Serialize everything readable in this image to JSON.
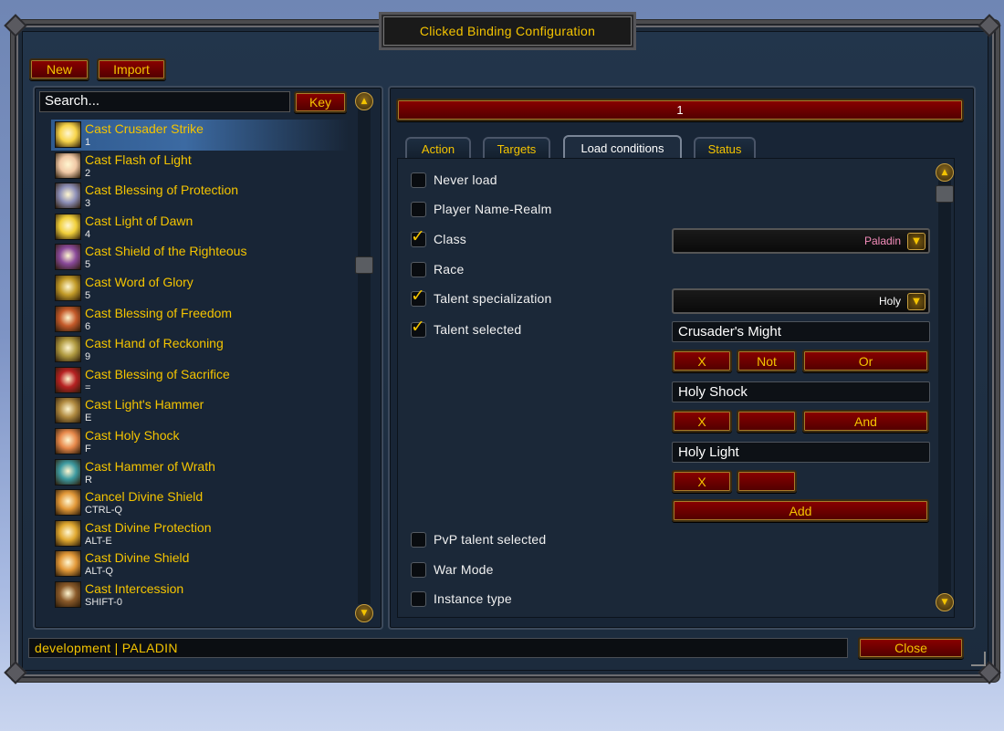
{
  "window": {
    "title": "Clicked Binding Configuration"
  },
  "toolbar": {
    "new_label": "New",
    "import_label": "Import"
  },
  "search": {
    "placeholder": "Search...",
    "key_label": "Key"
  },
  "bindings": [
    {
      "name": "Cast Crusader Strike",
      "key": "1",
      "icon": "crusader-strike-icon",
      "color": "#f7d44a",
      "selected": true
    },
    {
      "name": "Cast Flash of Light",
      "key": "2",
      "icon": "flash-of-light-icon",
      "color": "#f1c9a6"
    },
    {
      "name": "Cast Blessing of Protection",
      "key": "3",
      "icon": "blessing-of-protection-icon",
      "color": "#8d8fb8"
    },
    {
      "name": "Cast Light of Dawn",
      "key": "4",
      "icon": "light-of-dawn-icon",
      "color": "#f0cf3a"
    },
    {
      "name": "Cast Shield of the Righteous",
      "key": "5",
      "icon": "shield-of-the-righteous-icon",
      "color": "#8a4a9a"
    },
    {
      "name": "Cast Word of Glory",
      "key": "5",
      "icon": "word-of-glory-icon",
      "color": "#c29b28"
    },
    {
      "name": "Cast Blessing of Freedom",
      "key": "6",
      "icon": "blessing-of-freedom-icon",
      "color": "#c45a2a"
    },
    {
      "name": "Cast Hand of Reckoning",
      "key": "9",
      "icon": "hand-of-reckoning-icon",
      "color": "#b09a40"
    },
    {
      "name": "Cast Blessing of Sacrifice",
      "key": "=",
      "icon": "blessing-of-sacrifice-icon",
      "color": "#b72222"
    },
    {
      "name": "Cast Light's Hammer",
      "key": "E",
      "icon": "lights-hammer-icon",
      "color": "#b08a40"
    },
    {
      "name": "Cast Holy Shock",
      "key": "F",
      "icon": "holy-shock-icon",
      "color": "#e7884a"
    },
    {
      "name": "Cast Hammer of Wrath",
      "key": "R",
      "icon": "hammer-of-wrath-icon",
      "color": "#3d9aa0"
    },
    {
      "name": "Cancel Divine Shield",
      "key": "CTRL-Q",
      "icon": "divine-shield-icon",
      "color": "#e29838"
    },
    {
      "name": "Cast Divine Protection",
      "key": "ALT-E",
      "icon": "divine-protection-icon",
      "color": "#e0a830"
    },
    {
      "name": "Cast Divine Shield",
      "key": "ALT-Q",
      "icon": "divine-shield-icon",
      "color": "#e29838"
    },
    {
      "name": "Cast Intercession",
      "key": "SHIFT-0",
      "icon": "intercession-icon",
      "color": "#8a5a2a"
    }
  ],
  "detail": {
    "header_value": "1",
    "tabs": [
      "Action",
      "Targets",
      "Load conditions",
      "Status"
    ],
    "active_tab": "Load conditions"
  },
  "conditions": {
    "never_load": {
      "label": "Never load",
      "checked": false
    },
    "player_name_realm": {
      "label": "Player Name-Realm",
      "checked": false
    },
    "class": {
      "label": "Class",
      "checked": true,
      "value": "Paladin",
      "value_color": "#f48cba"
    },
    "race": {
      "label": "Race",
      "checked": false
    },
    "talent_spec": {
      "label": "Talent specialization",
      "checked": true,
      "value": "Holy"
    },
    "talent_selected": {
      "label": "Talent selected",
      "checked": true,
      "entries": [
        {
          "value": "Crusader's Might",
          "x_label": "X",
          "not_label": "Not",
          "op_label": "Or"
        },
        {
          "value": "Holy Shock",
          "x_label": "X",
          "not_label": "",
          "op_label": "And"
        },
        {
          "value": "Holy Light",
          "x_label": "X",
          "not_label": ""
        }
      ],
      "add_label": "Add"
    },
    "pvp_talent": {
      "label": "PvP talent selected",
      "checked": false
    },
    "war_mode": {
      "label": "War Mode",
      "checked": false
    },
    "instance_type": {
      "label": "Instance type",
      "checked": false
    }
  },
  "statusbar": {
    "text": "development | PALADIN",
    "close_label": "Close"
  },
  "colors": {
    "gold": "#f4c400",
    "button_red": "#8b0000",
    "panel": "#1d2a3a"
  }
}
